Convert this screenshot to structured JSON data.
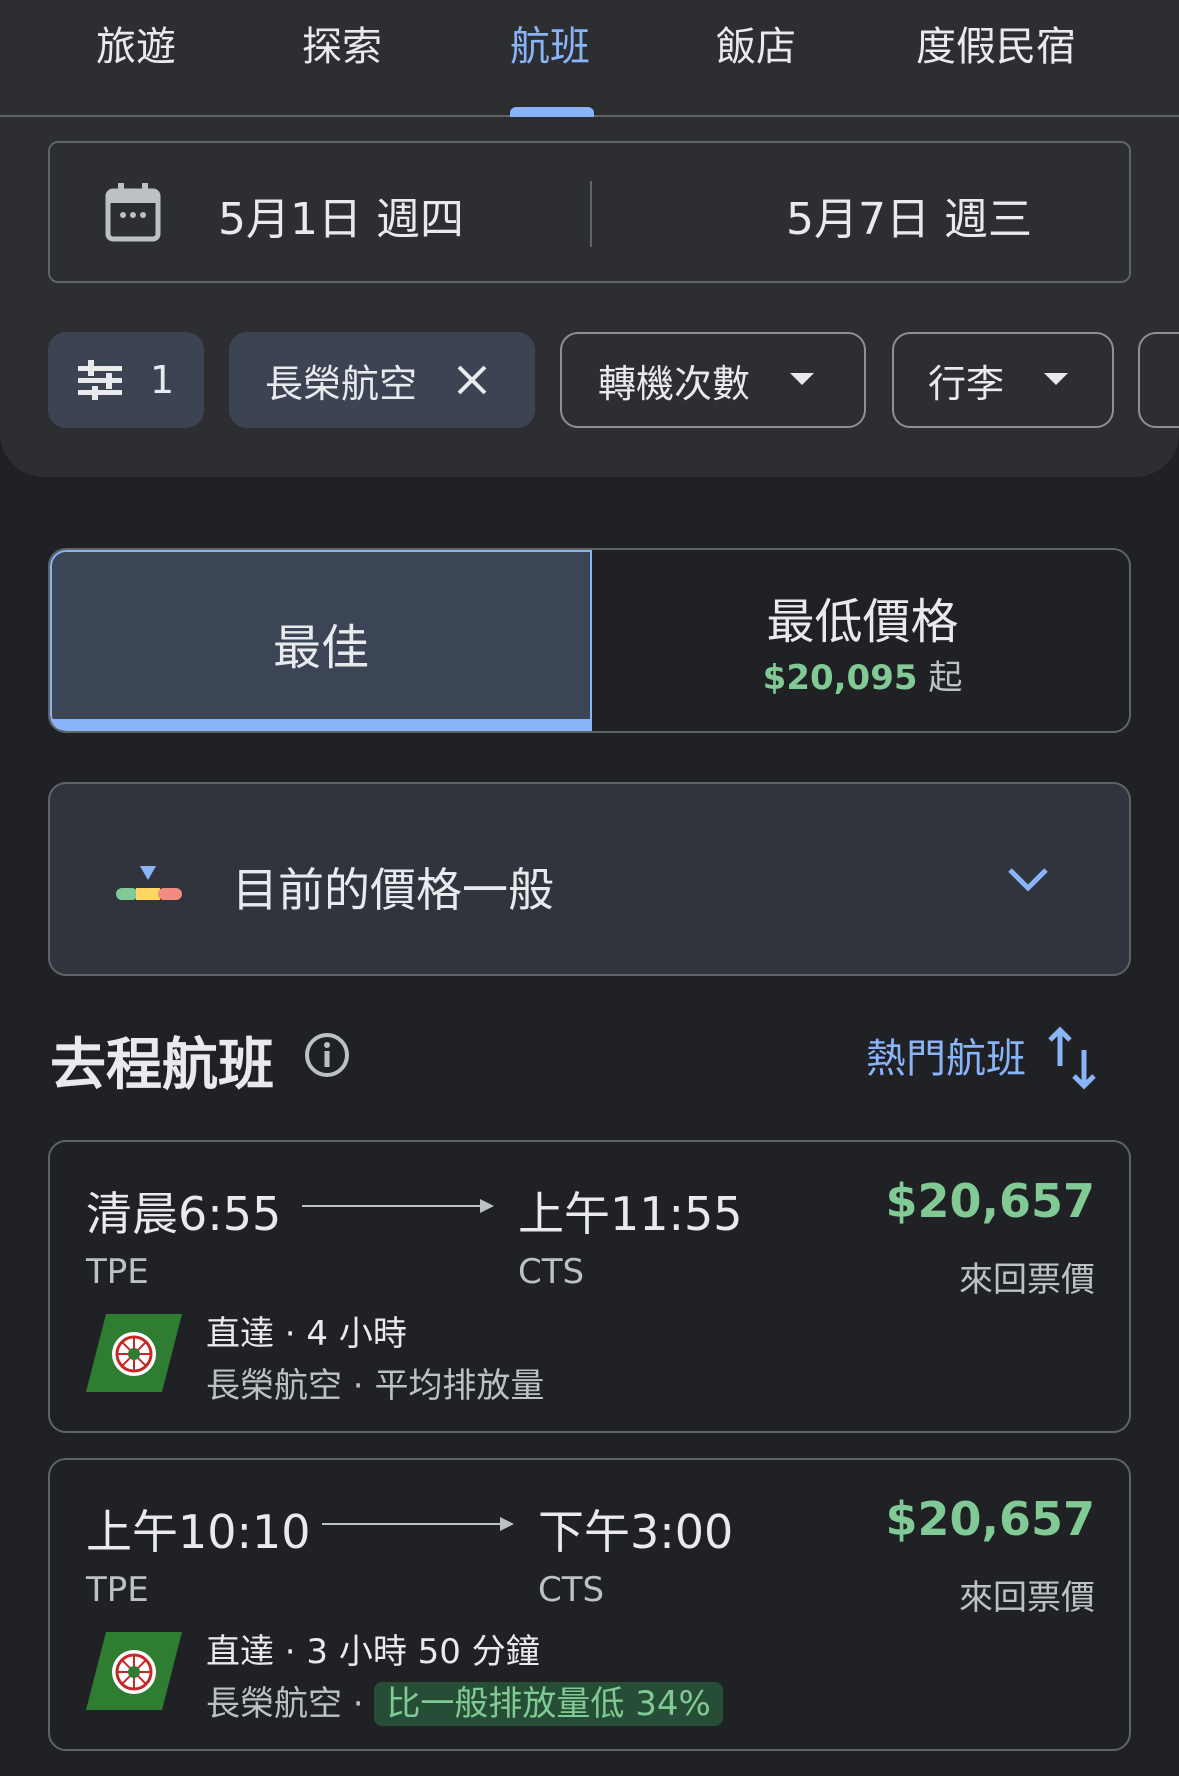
{
  "nav": {
    "tabs": [
      {
        "label": "旅遊"
      },
      {
        "label": "探索"
      },
      {
        "label": "航班"
      },
      {
        "label": "飯店"
      },
      {
        "label": "度假民宿"
      }
    ],
    "active": "航班"
  },
  "dates": {
    "depart": "5月1日 週四",
    "return": "5月7日 週三"
  },
  "filters": {
    "all_count": "1",
    "airline_chip": "長榮航空",
    "stops_chip": "轉機次數",
    "bags_chip": "行李"
  },
  "sort": {
    "best_label": "最佳",
    "cheapest_label": "最低價格",
    "cheapest_price": "$20,095",
    "cheapest_suffix": "起"
  },
  "price_insight": {
    "text": "目前的價格一般"
  },
  "section": {
    "title": "去程航班",
    "sort_link": "熱門航班"
  },
  "flights": [
    {
      "depart_time": "清晨6:55",
      "depart_code": "TPE",
      "arrive_time": "上午11:55",
      "arrive_code": "CTS",
      "price": "$20,657",
      "price_label": "來回票價",
      "stops_duration": "直達 · 4 小時",
      "airline": "長榮航空",
      "emissions": "平均排放量"
    },
    {
      "depart_time": "上午10:10",
      "depart_code": "TPE",
      "arrive_time": "下午3:00",
      "arrive_code": "CTS",
      "price": "$20,657",
      "price_label": "來回票價",
      "stops_duration": "直達 · 3 小時 50 分鐘",
      "airline": "長榮航空",
      "emissions": "比一般排放量低 34%"
    }
  ],
  "colors": {
    "accent": "#8ab4f8",
    "price_green": "#81c995",
    "background": "#202124",
    "panel": "#2d2e31"
  }
}
